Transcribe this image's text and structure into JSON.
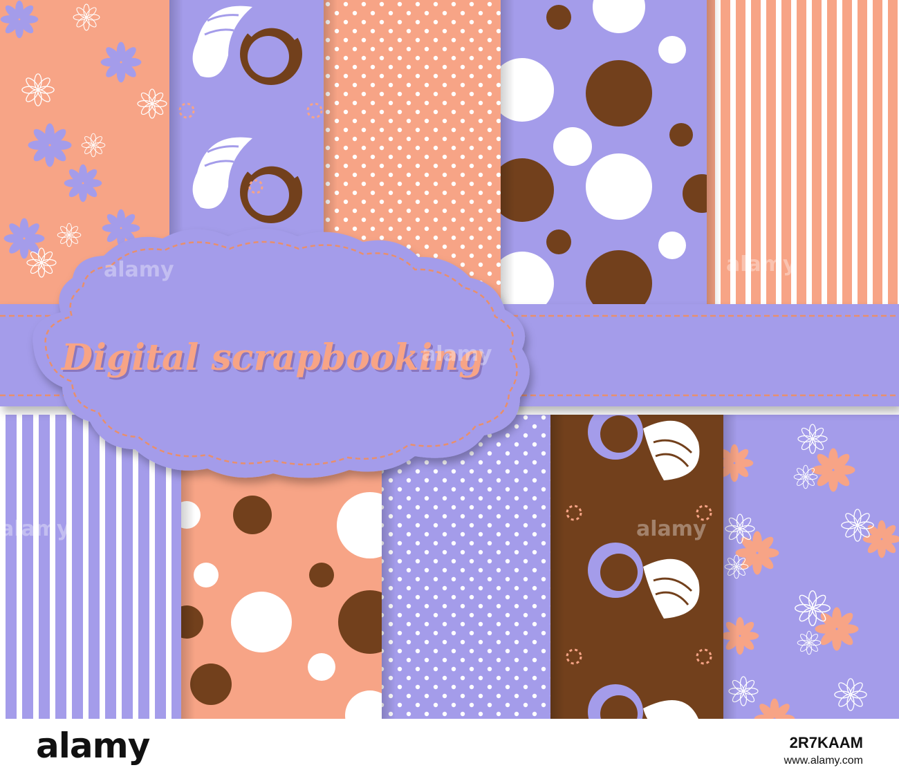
{
  "title": "Digital scrapbooking",
  "watermark": "alamy",
  "footer": {
    "logo": "alamy",
    "image_id": "2R7KAAM",
    "site": "www.alamy.com"
  },
  "colors": {
    "peach": "#f7a486",
    "lavender": "#a49cea",
    "brown": "#72401c",
    "white": "#ffffff",
    "stitch": "#e88f6c"
  },
  "papers": {
    "top": [
      {
        "pattern": "flowers",
        "background": "peach",
        "motif": "lavender"
      },
      {
        "pattern": "swirls",
        "background": "lavender",
        "motif": "brown"
      },
      {
        "pattern": "polka-dots",
        "background": "peach",
        "motif": "white"
      },
      {
        "pattern": "large-dots",
        "background": "lavender",
        "motif": "brown"
      },
      {
        "pattern": "stripes",
        "background": "peach",
        "motif": "white"
      }
    ],
    "bottom": [
      {
        "pattern": "stripes",
        "background": "lavender",
        "motif": "white"
      },
      {
        "pattern": "large-dots",
        "background": "peach",
        "motif": "brown"
      },
      {
        "pattern": "polka-dots",
        "background": "lavender",
        "motif": "white"
      },
      {
        "pattern": "swirls",
        "background": "brown",
        "motif": "lavender"
      },
      {
        "pattern": "flowers",
        "background": "lavender",
        "motif": "peach"
      }
    ]
  }
}
